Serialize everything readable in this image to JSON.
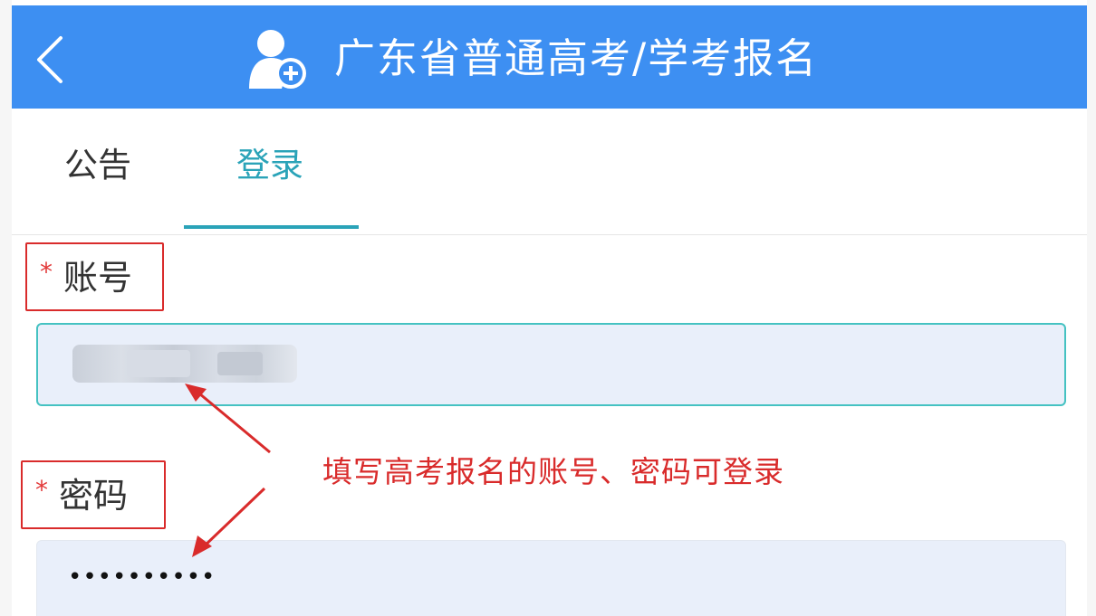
{
  "header": {
    "title": "广东省普通高考/学考报名",
    "background": "#3d8ff2",
    "back_icon": "chevron-left-icon",
    "title_icon": "user-add-icon"
  },
  "tabs": [
    {
      "label": "公告",
      "active": false
    },
    {
      "label": "登录",
      "active": true
    }
  ],
  "accent": "#2aa3b8",
  "form": {
    "account": {
      "required_mark": "*",
      "label": "账号"
    },
    "password": {
      "required_mark": "*",
      "label": "密码",
      "masked_value": "••••••••••"
    }
  },
  "annotation": {
    "text": "填写高考报名的账号、密码可登录",
    "color": "#d92b2b"
  }
}
